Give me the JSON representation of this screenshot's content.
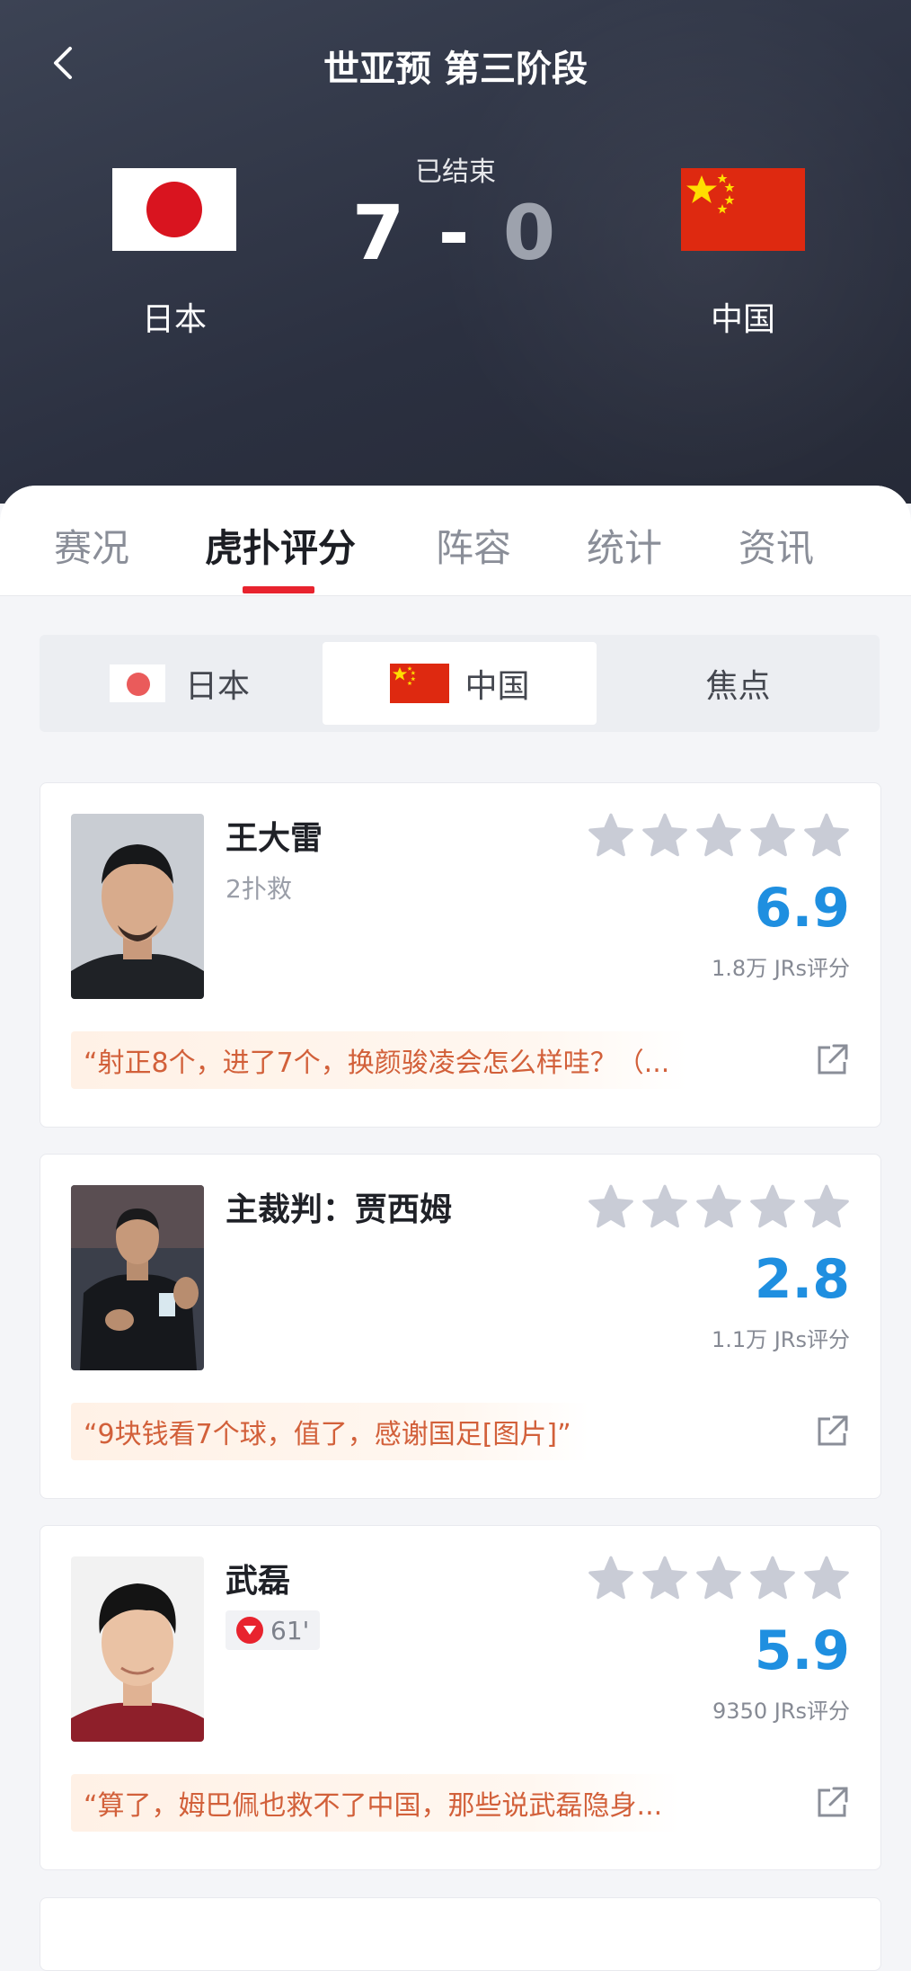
{
  "header": {
    "title": "世亚预 第三阶段",
    "status": "已结束",
    "home": {
      "name": "日本",
      "score": "7"
    },
    "score_sep": "-",
    "away": {
      "name": "中国",
      "score": "0"
    }
  },
  "tabs": [
    {
      "label": "赛况"
    },
    {
      "label": "虎扑评分"
    },
    {
      "label": "阵容"
    },
    {
      "label": "统计"
    },
    {
      "label": "资讯"
    }
  ],
  "segments": [
    {
      "label": "日本"
    },
    {
      "label": "中国"
    },
    {
      "label": "焦点"
    }
  ],
  "cards": [
    {
      "name": "王大雷",
      "sub": "2扑救",
      "rating": "6.9",
      "count": "1.8万 JRs评分",
      "comment": "“射正8个，进了7个，换颜骏凌会怎么样哇？（..."
    },
    {
      "name": "主裁判：贾西姆",
      "rating": "2.8",
      "count": "1.1万 JRs评分",
      "comment": "“9块钱看7个球，值了，感谢国足[图片]”"
    },
    {
      "name": "武磊",
      "sub": "61'",
      "rating": "5.9",
      "count": "9350 JRs评分",
      "comment": "“算了，姆巴佩也救不了中国，那些说武磊隐身..."
    }
  ],
  "colors": {
    "accent": "#e8232e",
    "rating": "#1f8fe0",
    "comment_text": "#d2603a",
    "star": "#c9ccd6"
  }
}
